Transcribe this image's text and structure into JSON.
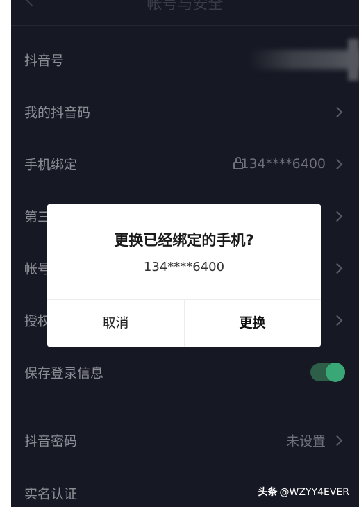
{
  "header": {
    "title": "帐号与安全"
  },
  "rows": [
    {
      "label": "抖音号"
    },
    {
      "label": "我的抖音码"
    },
    {
      "label": "手机绑定",
      "value": "134****6400"
    },
    {
      "label": "第三"
    },
    {
      "label": "帐号"
    },
    {
      "label": "授权"
    },
    {
      "label": "保存登录信息",
      "toggle_on": true
    },
    {
      "label": "抖音密码",
      "value": "未设置"
    },
    {
      "label": "实名认证"
    }
  ],
  "dialog": {
    "title": "更换已经绑定的手机?",
    "phone": "134****6400",
    "cancel_label": "取消",
    "confirm_label": "更换"
  },
  "watermark": {
    "brand": "头条",
    "handle": "@WZYY4EVER"
  },
  "colors": {
    "background": "#161823",
    "toggle_track": "#2d5e47",
    "toggle_knob": "#3aa876",
    "dialog_bg": "#ffffff"
  }
}
